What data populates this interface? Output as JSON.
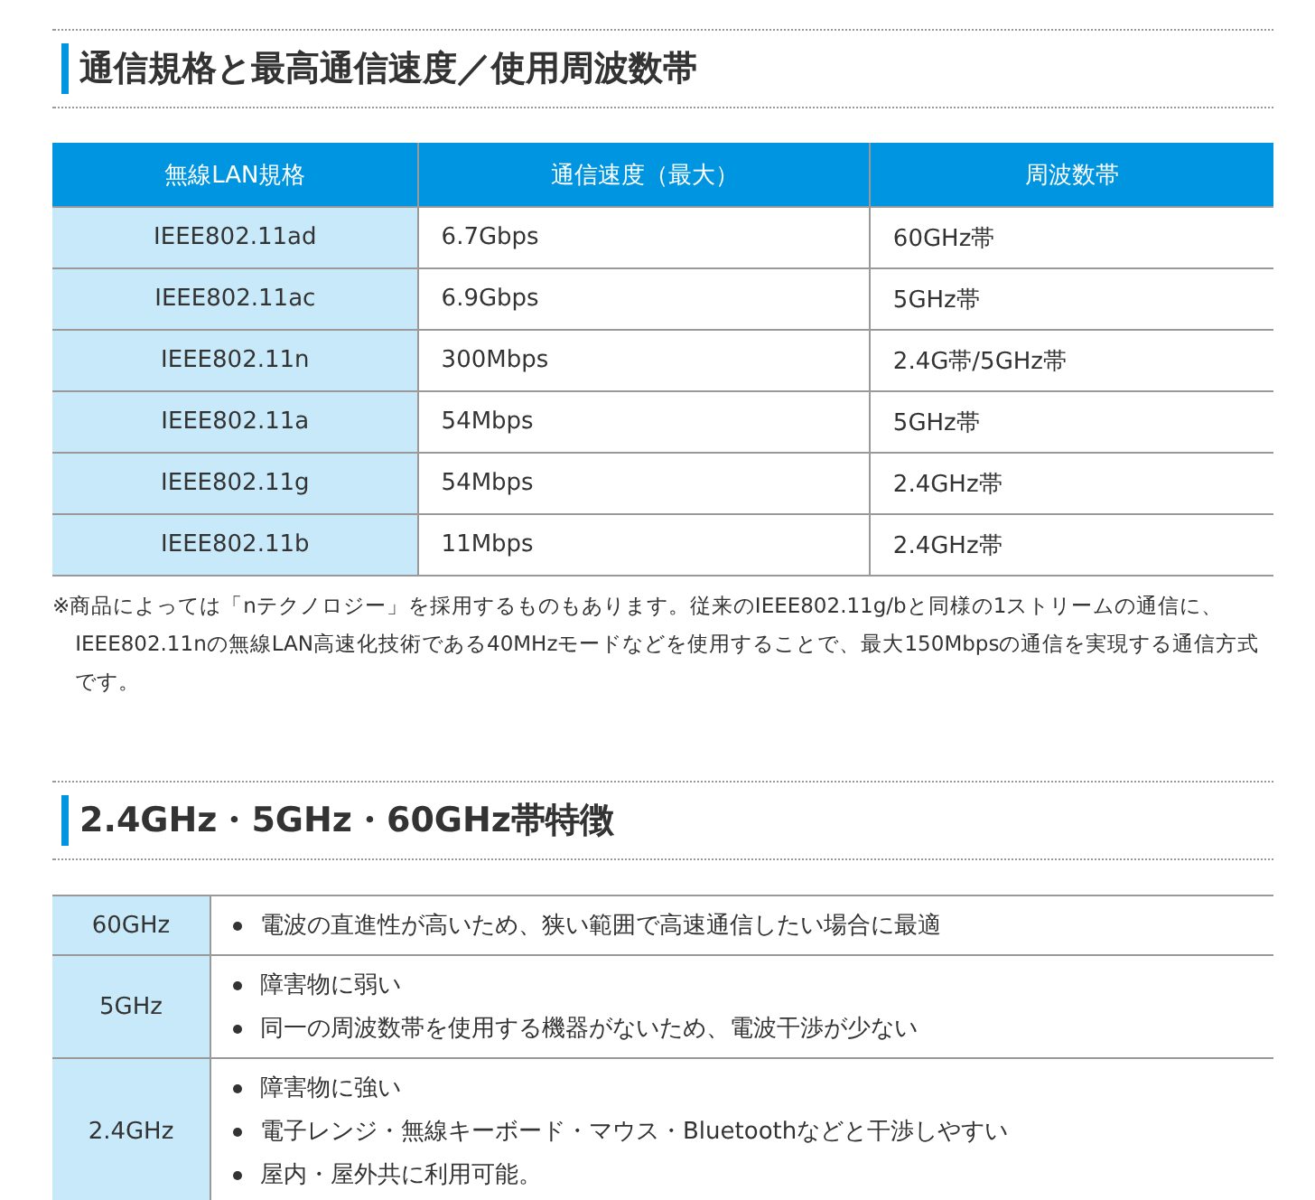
{
  "section1": {
    "heading": "通信規格と最高通信速度／使用周波数帯",
    "table": {
      "columns": [
        "無線LAN規格",
        "通信速度（最大）",
        "周波数帯"
      ],
      "rows": [
        [
          "IEEE802.11ad",
          "6.7Gbps",
          "60GHz帯"
        ],
        [
          "IEEE802.11ac",
          "6.9Gbps",
          "5GHz帯"
        ],
        [
          "IEEE802.11n",
          "300Mbps",
          "2.4G帯/5GHz帯"
        ],
        [
          "IEEE802.11a",
          "54Mbps",
          "5GHz帯"
        ],
        [
          "IEEE802.11g",
          "54Mbps",
          "2.4GHz帯"
        ],
        [
          "IEEE802.11b",
          "11Mbps",
          "2.4GHz帯"
        ]
      ]
    },
    "note": "※商品によっては「nテクノロジー」を採用するものもあります。従来のIEEE802.11g/bと同様の1ストリームの通信に、IEEE802.11nの無線LAN高速化技術である40MHzモードなどを使用することで、最大150Mbpsの通信を実現する通信方式です。"
  },
  "section2": {
    "heading": "2.4GHz・5GHz・60GHz帯特徴",
    "rows": [
      {
        "band": "60GHz",
        "points": [
          "電波の直進性が高いため、狭い範囲で高速通信したい場合に最適"
        ]
      },
      {
        "band": "5GHz",
        "points": [
          "障害物に弱い",
          "同一の周波数帯を使用する機器がないため、電波干渉が少ない"
        ]
      },
      {
        "band": "2.4GHz",
        "points": [
          "障害物に強い",
          "電子レンジ・無線キーボード・マウス・Bluetoothなどと干渉しやすい",
          "屋内・屋外共に利用可能。"
        ]
      }
    ]
  }
}
